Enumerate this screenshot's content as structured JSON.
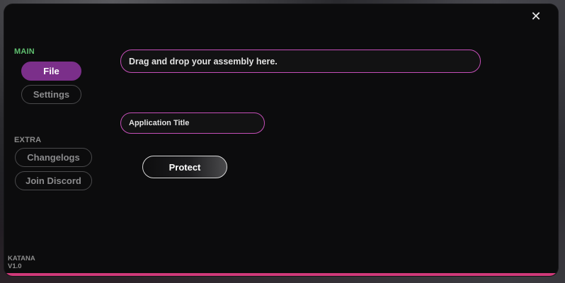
{
  "window": {
    "close_icon": "close-icon",
    "accent_color": "#d03a7a",
    "active_nav_color": "#7b2f8a",
    "input_border_color": "#c64fb9"
  },
  "sidebar": {
    "main_label": "MAIN",
    "main_items": [
      {
        "label": "File",
        "active": true
      },
      {
        "label": "Settings",
        "active": false
      }
    ],
    "extra_label": "EXTRA",
    "extra_items": [
      {
        "label": "Changelogs"
      },
      {
        "label": "Join Discord"
      }
    ]
  },
  "main": {
    "assembly_input_text": "Drag and drop your assembly here.",
    "title_input_text": "Application Title",
    "protect_label": "Protect"
  },
  "brand": {
    "name": "KATANA",
    "version": "V1.0"
  }
}
